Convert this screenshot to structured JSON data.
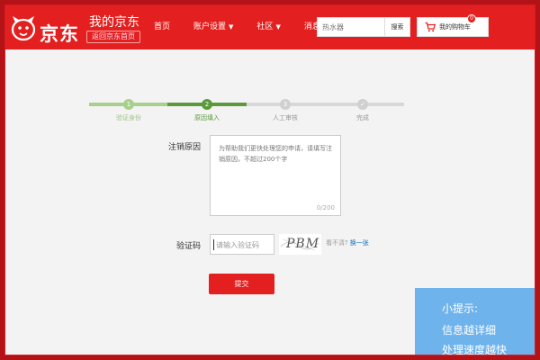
{
  "header": {
    "logo_text": "京东",
    "my_jd": "我的京东",
    "back_home": "返回京东首页",
    "nav": [
      {
        "label": "首页",
        "has_dropdown": false
      },
      {
        "label": "账户设置",
        "has_dropdown": true
      },
      {
        "label": "社区",
        "has_dropdown": true
      },
      {
        "label": "消息",
        "has_dropdown": false
      }
    ],
    "search": {
      "placeholder": "热水器",
      "button": "搜索"
    },
    "cart": {
      "label": "我的购物车",
      "count": "0"
    },
    "brand_color": "#e3201f"
  },
  "steps": [
    {
      "num": "1",
      "label": "验证身份",
      "state": "done"
    },
    {
      "num": "2",
      "label": "原因填入",
      "state": "active"
    },
    {
      "num": "3",
      "label": "人工审核",
      "state": "todo"
    },
    {
      "num": "✓",
      "label": "完成",
      "state": "todo"
    }
  ],
  "form": {
    "reason_label": "注销原因",
    "reason_placeholder": "为帮助我们更快处理您的申请，请填写注销原因，不超过200个字",
    "reason_count": "0/200",
    "captcha_label": "验证码",
    "captcha_placeholder": "请输入验证码",
    "captcha_image_text": "PBM",
    "captcha_help": "看不清?",
    "captcha_refresh": "换一张",
    "submit": "提交"
  },
  "tip": {
    "title": "小提示:",
    "lines": [
      "信息越详细",
      "处理速度越快"
    ]
  }
}
